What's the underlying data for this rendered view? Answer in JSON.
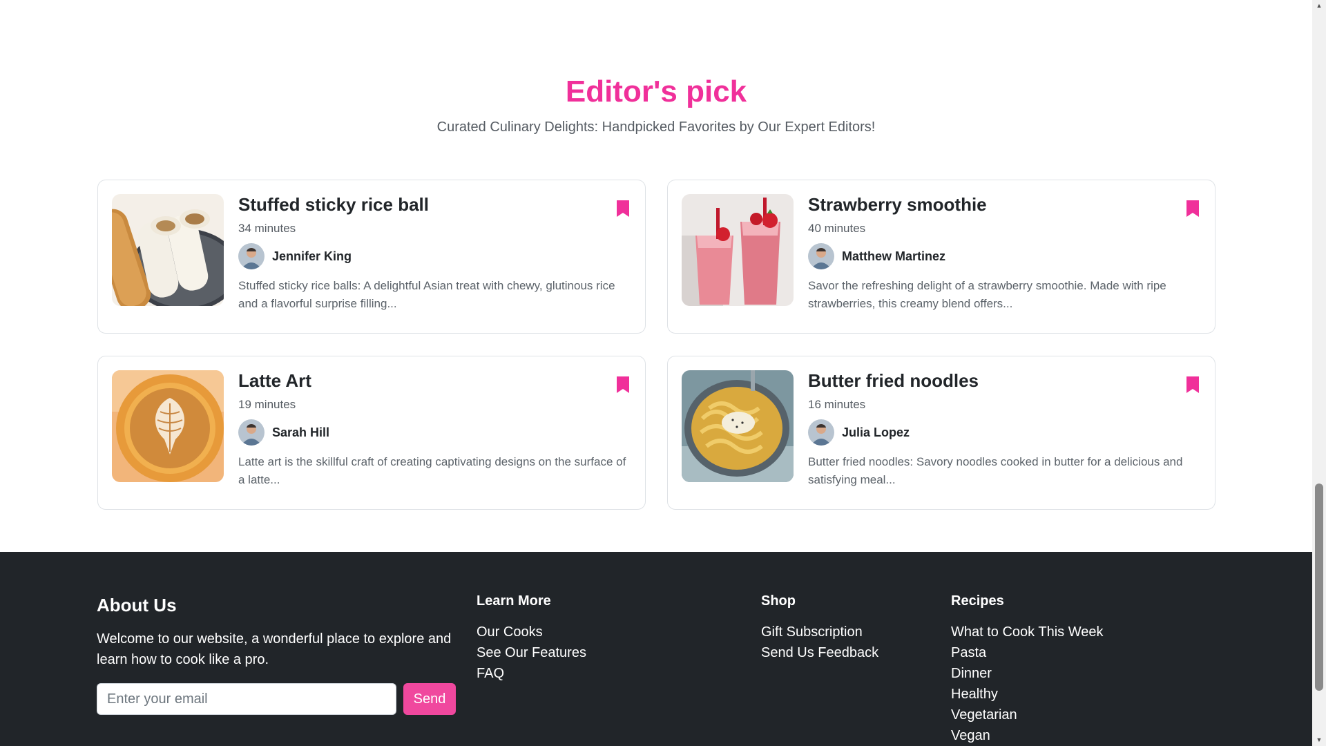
{
  "section": {
    "title": "Editor's pick",
    "subtitle": "Curated Culinary Delights: Handpicked Favorites by Our Expert Editors!"
  },
  "cards": [
    {
      "title": "Stuffed sticky rice ball",
      "time": "34 minutes",
      "author": "Jennifer King",
      "description": "Stuffed sticky rice balls: A delightful Asian treat with chewy, glutinous rice and a flavorful surprise filling...",
      "image_icon": "rice-ball-photo"
    },
    {
      "title": "Strawberry smoothie",
      "time": "40 minutes",
      "author": "Matthew Martinez",
      "description": "Savor the refreshing delight of a strawberry smoothie. Made with ripe strawberries, this creamy blend offers...",
      "image_icon": "strawberry-smoothie-photo"
    },
    {
      "title": "Latte Art",
      "time": "19 minutes",
      "author": "Sarah Hill",
      "description": "Latte art is the skillful craft of creating captivating designs on the surface of a latte...",
      "image_icon": "latte-art-photo"
    },
    {
      "title": "Butter fried noodles",
      "time": "16 minutes",
      "author": "Julia Lopez",
      "description": "Butter fried noodles: Savory noodles cooked in butter for a delicious and satisfying meal...",
      "image_icon": "butter-noodles-photo"
    }
  ],
  "footer": {
    "about": {
      "title": "About Us",
      "text": "Welcome to our website, a wonderful place to explore and learn how to cook like a pro.",
      "email_placeholder": "Enter your email",
      "send_label": "Send"
    },
    "learn_more": {
      "title": "Learn More",
      "links": [
        "Our Cooks",
        "See Our Features",
        "FAQ"
      ]
    },
    "shop": {
      "title": "Shop",
      "links": [
        "Gift Subscription",
        "Send Us Feedback"
      ]
    },
    "recipes": {
      "title": "Recipes",
      "links": [
        "What to Cook This Week",
        "Pasta",
        "Dinner",
        "Healthy",
        "Vegetarian",
        "Vegan"
      ]
    }
  },
  "colors": {
    "accent": "#f0309a",
    "send_button": "#f0489e",
    "footer_bg": "#212529"
  }
}
